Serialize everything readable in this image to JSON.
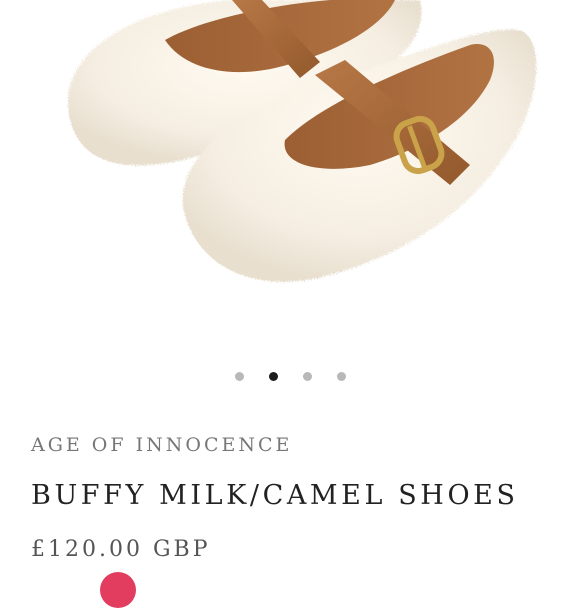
{
  "product": {
    "brand": "AGE OF INNOCENCE",
    "title": "BUFFY MILK/CAMEL SHOES",
    "price": "£120.00 GBP",
    "image_alt": "Fluffy cream shearling ballet flats with camel leather strap and gold buckle"
  },
  "carousel": {
    "total": 4,
    "active_index": 1
  },
  "colors": {
    "fur": "#f7f1e6",
    "leather": "#a86b3c",
    "buckle": "#c9a24a",
    "badge": "#e23d5f",
    "dot_active": "#1c1c1c",
    "dot_inactive": "#b8b8b8"
  }
}
